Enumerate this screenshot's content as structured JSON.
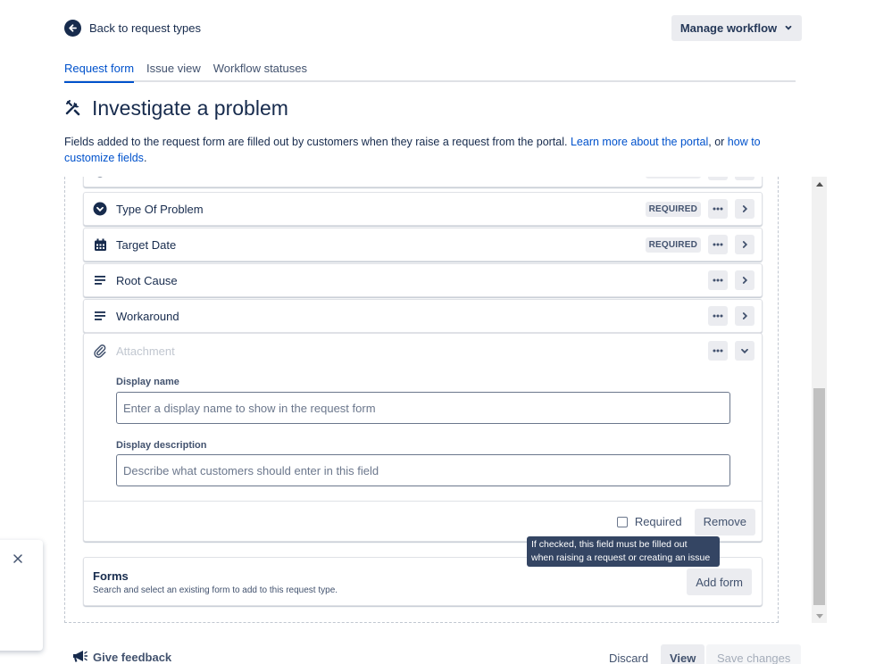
{
  "nav": {
    "back_label": "Back to request types",
    "manage_workflow_label": "Manage workflow"
  },
  "tabs": [
    {
      "label": "Request form",
      "active": true
    },
    {
      "label": "Issue view",
      "active": false
    },
    {
      "label": "Workflow statuses",
      "active": false
    }
  ],
  "page": {
    "title": "Investigate a problem",
    "description_prefix": "Fields added to the request form are filled out by customers when they raise a request from the portal. ",
    "link_portal": "Learn more about the portal",
    "description_mid": ", or ",
    "link_fields": "how to customize fields",
    "description_suffix": "."
  },
  "fields": [
    {
      "label": "Type Of Problem",
      "icon": "dropdown-icon",
      "badge": "REQUIRED"
    },
    {
      "label": "Target Date",
      "icon": "calendar-icon",
      "badge": "REQUIRED"
    },
    {
      "label": "Root Cause",
      "icon": "paragraph-icon",
      "badge": ""
    },
    {
      "label": "Workaround",
      "icon": "paragraph-icon",
      "badge": ""
    }
  ],
  "attachment": {
    "label": "Attachment",
    "display_name_label": "Display name",
    "display_name_placeholder": "Enter a display name to show in the request form",
    "display_desc_label": "Display description",
    "display_desc_placeholder": "Describe what customers should enter in this field",
    "required_label": "Required",
    "remove_label": "Remove"
  },
  "tooltip": {
    "line1": "If checked, this field must be filled out",
    "line2": "when raising a request or creating an issue"
  },
  "forms_section": {
    "title": "Forms",
    "subtitle": "Search and select an existing form to add to this request type.",
    "add_label": "Add form"
  },
  "footer": {
    "feedback_label": "Give feedback",
    "discard_label": "Discard",
    "view_label": "View",
    "save_label": "Save changes"
  },
  "colors": {
    "link": "#0052cc",
    "text": "#172b4d",
    "subtle_bg": "#ebecf0"
  }
}
